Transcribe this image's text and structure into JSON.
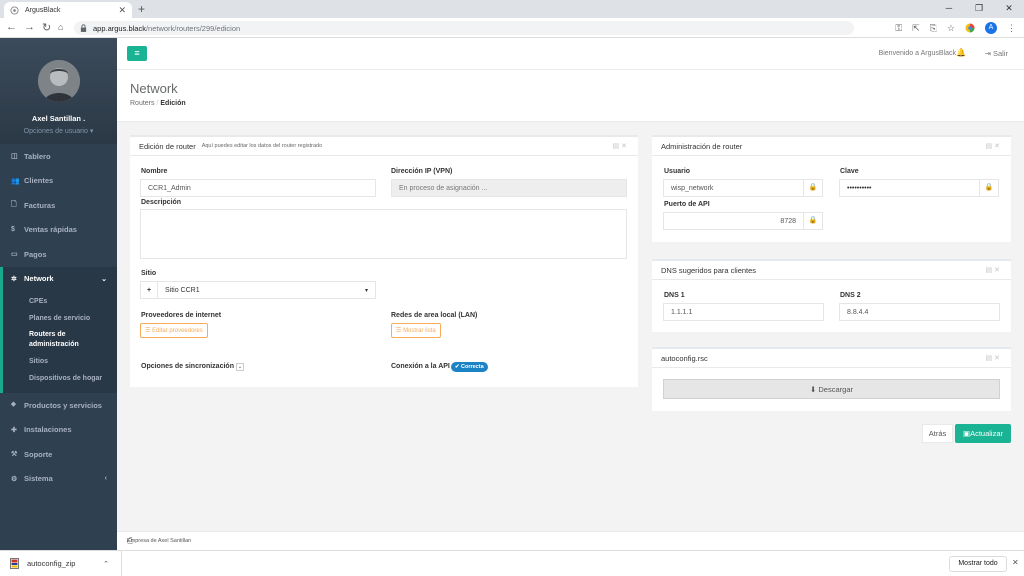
{
  "browser": {
    "tab_title": "ArgusBlack",
    "url_host": "app.argus.black",
    "url_path": "/network/routers/299/edicion",
    "profile_initial": "A"
  },
  "user": {
    "name": "Axel Santillan .",
    "options_label": "Opciones de usuario"
  },
  "sidebar": {
    "items": [
      {
        "label": "Tablero",
        "icon": "dashboard-icon"
      },
      {
        "label": "Clientes",
        "icon": "users-icon"
      },
      {
        "label": "Facturas",
        "icon": "invoice-icon"
      },
      {
        "label": "Ventas rápidas",
        "icon": "dollar-icon"
      },
      {
        "label": "Pagos",
        "icon": "payments-icon"
      }
    ],
    "network": {
      "label": "Network",
      "sub": [
        "CPEs",
        "Planes de servicio",
        "Routers de administración",
        "Sitios",
        "Dispositivos de hogar"
      ]
    },
    "items_after": [
      {
        "label": "Productos y servicios",
        "icon": "tags-icon"
      },
      {
        "label": "Instalaciones",
        "icon": "puzzle-icon"
      },
      {
        "label": "Soporte",
        "icon": "wrench-icon"
      },
      {
        "label": "Sistema",
        "icon": "cogs-icon"
      }
    ]
  },
  "topbar": {
    "welcome": "Bienvenido a ArgusBlack",
    "logout": "Salir"
  },
  "page": {
    "title": "Network",
    "breadcrumb_parent": "Routers",
    "breadcrumb_current": "Edición"
  },
  "edit_router": {
    "title": "Edición de router",
    "subtitle": "Aquí puedes editar los datos del router registrado",
    "name_label": "Nombre",
    "name_value": "CCR1_Admin",
    "ip_label": "Dirección IP (VPN)",
    "ip_value": "En proceso de asignación ...",
    "desc_label": "Descripción",
    "site_label": "Sitio",
    "site_value": "Sitio CCR1",
    "isp_label": "Proveedores de internet",
    "isp_button": "Editar proveedores",
    "lan_label": "Redes de area local (LAN)",
    "lan_button": "Mostrar lista",
    "sync_label": "Opciones de sincronización",
    "api_label": "Conexión a la API",
    "api_status": "Correcta"
  },
  "admin_router": {
    "title": "Administración de router",
    "user_label": "Usuario",
    "user_value": "wisp_network",
    "pass_label": "Clave",
    "pass_value": "••••••••••",
    "port_label": "Puerto de API",
    "port_value": "8728"
  },
  "dns": {
    "title": "DNS sugeridos para clientes",
    "dns1_label": "DNS 1",
    "dns1_value": "1.1.1.1",
    "dns2_label": "DNS 2",
    "dns2_value": "8.8.4.4"
  },
  "autoconfig": {
    "title": "autoconfig.rsc",
    "download": "Descargar"
  },
  "actions": {
    "back": "Atrás",
    "update": "Actualizar"
  },
  "footer": {
    "text": "Empresa de Axel Santillan"
  },
  "downloads": {
    "file": "autoconfig_zip",
    "show_all": "Mostrar todo"
  },
  "colors": {
    "sidebar": "#2f4050",
    "accent": "#1ab394",
    "warning": "#f8ac59",
    "badge": "#1c84c6"
  }
}
